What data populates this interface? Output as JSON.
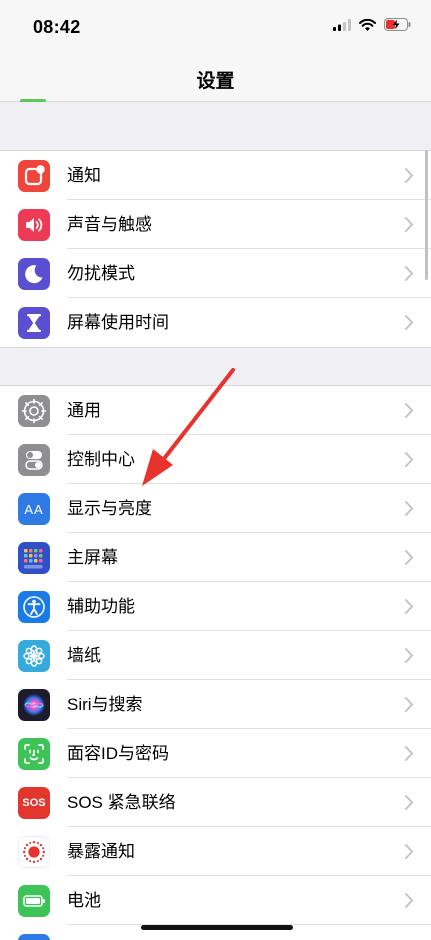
{
  "status_bar": {
    "time": "08:42",
    "icons": [
      "cellular-signal-icon",
      "wifi-icon",
      "battery-charging-icon"
    ]
  },
  "nav": {
    "title": "设置"
  },
  "groups": [
    {
      "items": [
        {
          "label": "通知",
          "icon": "notifications-icon",
          "color": "#f0453a"
        },
        {
          "label": "声音与触感",
          "icon": "speaker-icon",
          "color": "#ed3b55"
        },
        {
          "label": "勿扰模式",
          "icon": "moon-icon",
          "color": "#5a4fd1"
        },
        {
          "label": "屏幕使用时间",
          "icon": "hourglass-icon",
          "color": "#5a4fd1"
        }
      ]
    },
    {
      "items": [
        {
          "label": "通用",
          "icon": "gear-icon",
          "color": "#8e8e93"
        },
        {
          "label": "控制中心",
          "icon": "toggles-icon",
          "color": "#8e8e93"
        },
        {
          "label": "显示与亮度",
          "icon": "text-size-icon",
          "icon_text": "AA",
          "color": "#2f7ae5"
        },
        {
          "label": "主屏幕",
          "icon": "app-grid-icon",
          "color": "#3050c8"
        },
        {
          "label": "辅助功能",
          "icon": "accessibility-icon",
          "color": "#1a7be8"
        },
        {
          "label": "墙纸",
          "icon": "flower-icon",
          "color": "#36aadc"
        },
        {
          "label": "Siri与搜索",
          "icon": "siri-icon",
          "color": "#1c1c2e"
        },
        {
          "label": "面容ID与密码",
          "icon": "face-id-icon",
          "color": "#3ec357"
        },
        {
          "label": "SOS 紧急联络",
          "icon": "sos-icon",
          "icon_text": "SOS",
          "color": "#e3362d"
        },
        {
          "label": "暴露通知",
          "icon": "exposure-icon",
          "color": "#ffffff"
        },
        {
          "label": "电池",
          "icon": "battery-icon",
          "color": "#3ec357"
        }
      ]
    }
  ],
  "annotation": {
    "icon": "red-pointer-arrow-icon",
    "color": "#e8322c"
  }
}
